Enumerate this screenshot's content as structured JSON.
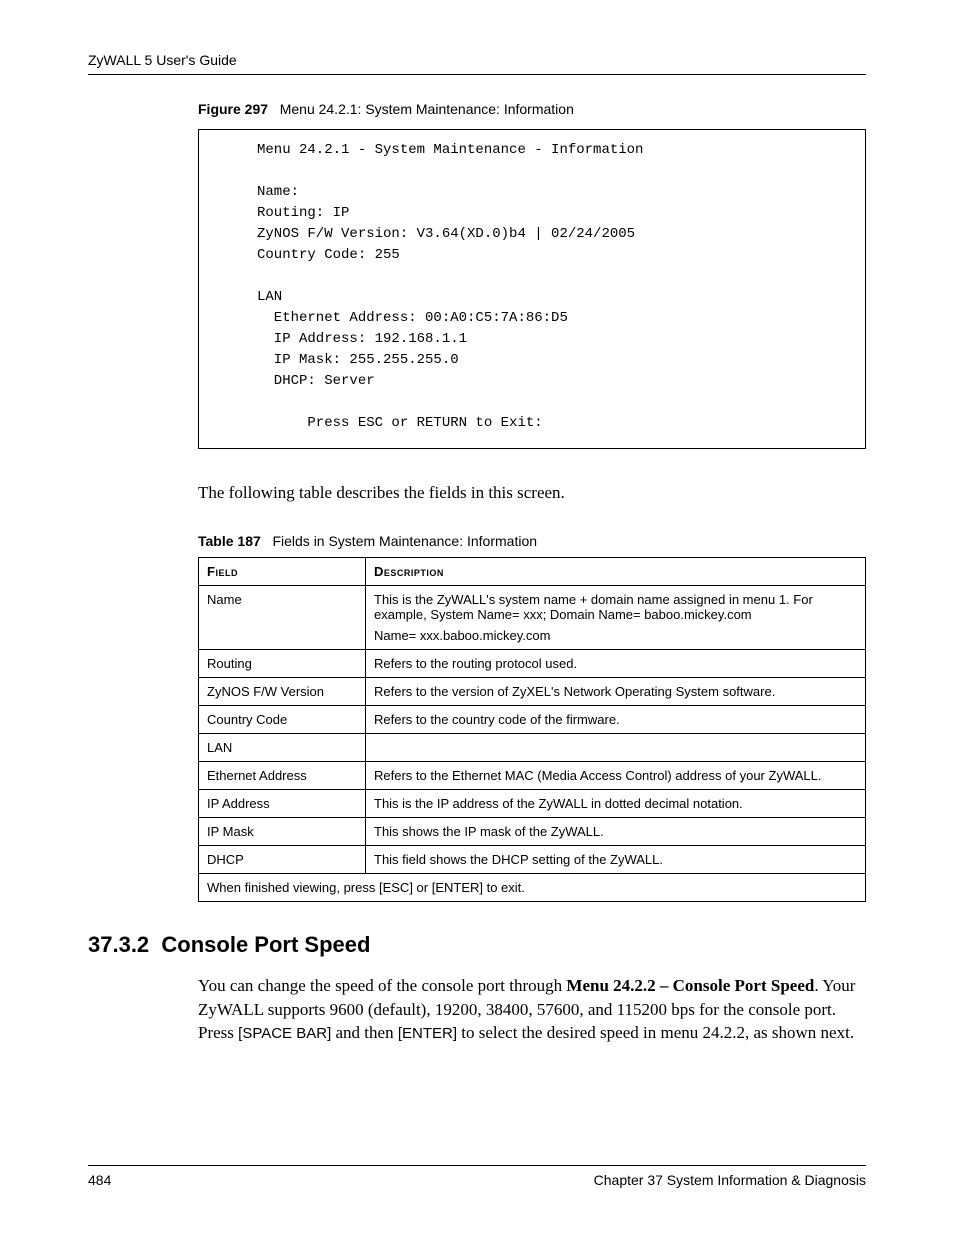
{
  "header": {
    "left": "ZyWALL 5 User's Guide"
  },
  "figure": {
    "label": "Figure 297",
    "title": "Menu 24.2.1: System Maintenance: Information",
    "terminal": "Menu 24.2.1 - System Maintenance - Information\n\nName:\nRouting: IP\nZyNOS F/W Version: V3.64(XD.0)b4 | 02/24/2005\nCountry Code: 255\n\nLAN\n  Ethernet Address: 00:A0:C5:7A:86:D5\n  IP Address: 192.168.1.1\n  IP Mask: 255.255.255.0\n  DHCP: Server\n\n      Press ESC or RETURN to Exit:"
  },
  "intro": "The following table describes the fields in this screen.",
  "table": {
    "label": "Table 187",
    "title": "Fields in System Maintenance: Information",
    "headers": {
      "field": "Field",
      "description": "Description"
    },
    "rows": [
      {
        "field": "Name",
        "desc": "This is the ZyWALL's system name + domain name assigned in menu 1. For example, System Name= xxx; Domain Name= baboo.mickey.com\nName= xxx.baboo.mickey.com"
      },
      {
        "field": "Routing",
        "desc": "Refers to the routing protocol used."
      },
      {
        "field": "ZyNOS F/W Version",
        "desc": "Refers to the version of ZyXEL's Network Operating System software."
      },
      {
        "field": "Country Code",
        "desc": "Refers to the country code of the firmware."
      },
      {
        "field": "LAN",
        "desc": ""
      },
      {
        "field": "Ethernet Address",
        "desc": "Refers to the Ethernet MAC (Media Access Control) address of your ZyWALL."
      },
      {
        "field": "IP Address",
        "desc": "This is the IP address of the ZyWALL in dotted decimal notation."
      },
      {
        "field": "IP Mask",
        "desc": "This shows the IP mask of the ZyWALL."
      },
      {
        "field": "DHCP",
        "desc": "This field shows the DHCP setting of the ZyWALL."
      }
    ],
    "footer": "When finished viewing, press [ESC] or [ENTER] to exit."
  },
  "section": {
    "number": "37.3.2",
    "title": "Console Port Speed",
    "body_pre": "You can change the speed of the console port through ",
    "body_bold": "Menu 24.2.2 – Console Port Speed",
    "body_mid1": ". Your ZyWALL supports 9600 (default), 19200, 38400, 57600, and 115200 bps for the console port. Press ",
    "body_key1": "[SPACE BAR]",
    "body_mid2": " and then ",
    "body_key2": "[ENTER]",
    "body_post": " to select the desired speed in menu 24.2.2, as shown next."
  },
  "footer": {
    "page": "484",
    "chapter": "Chapter 37 System Information & Diagnosis"
  }
}
